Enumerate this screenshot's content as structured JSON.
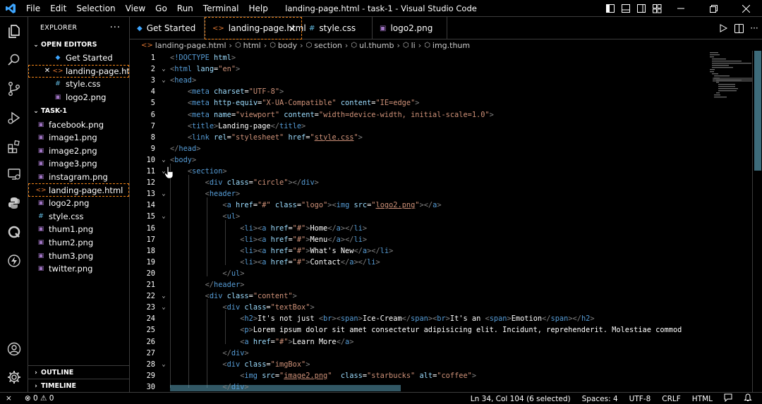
{
  "window": {
    "title": "landing-page.html - task-1 - Visual Studio Code"
  },
  "menu": [
    "File",
    "Edit",
    "Selection",
    "View",
    "Go",
    "Run",
    "Terminal",
    "Help"
  ],
  "sidebar": {
    "header": "EXPLORER",
    "open_editors_label": "OPEN EDITORS",
    "open_editors": [
      {
        "name": "Get Started",
        "icon": "vscode-icon"
      },
      {
        "name": "landing-page.ht...",
        "icon": "html-icon",
        "active": true
      },
      {
        "name": "style.css",
        "icon": "css-icon"
      },
      {
        "name": "logo2.png",
        "icon": "image-icon"
      }
    ],
    "folder_label": "TASK-1",
    "files": [
      {
        "name": "facebook.png",
        "icon": "image-icon"
      },
      {
        "name": "image1.png",
        "icon": "image-icon"
      },
      {
        "name": "image2.png",
        "icon": "image-icon"
      },
      {
        "name": "image3.png",
        "icon": "image-icon"
      },
      {
        "name": "instagram.png",
        "icon": "image-icon"
      },
      {
        "name": "landing-page.html",
        "icon": "html-icon",
        "active": true
      },
      {
        "name": "logo2.png",
        "icon": "image-icon"
      },
      {
        "name": "style.css",
        "icon": "css-icon"
      },
      {
        "name": "thum1.png",
        "icon": "image-icon"
      },
      {
        "name": "thum2.png",
        "icon": "image-icon"
      },
      {
        "name": "thum3.png",
        "icon": "image-icon"
      },
      {
        "name": "twitter.png",
        "icon": "image-icon"
      }
    ],
    "outline_label": "OUTLINE",
    "timeline_label": "TIMELINE"
  },
  "tabs": [
    {
      "label": "Get Started",
      "icon": "vscode-icon"
    },
    {
      "label": "landing-page.html",
      "icon": "html-icon",
      "active": true
    },
    {
      "label": "style.css",
      "icon": "css-icon"
    },
    {
      "label": "logo2.png",
      "icon": "image-icon"
    }
  ],
  "breadcrumb": [
    "landing-page.html",
    "html",
    "body",
    "section",
    "ul.thumb",
    "li",
    "img.thum"
  ],
  "editor": {
    "lines": [
      {
        "n": "1",
        "fold": "",
        "code": "<!DOCTYPE html>"
      },
      {
        "n": "2",
        "fold": "⌄",
        "code": "<html lang=\"en\">"
      },
      {
        "n": "3",
        "fold": "⌄",
        "code": "<head>"
      },
      {
        "n": "4",
        "fold": "",
        "code": "    <meta charset=\"UTF-8\">"
      },
      {
        "n": "5",
        "fold": "",
        "code": "    <meta http-equiv=\"X-UA-Compatible\" content=\"IE=edge\">"
      },
      {
        "n": "6",
        "fold": "",
        "code": "    <meta name=\"viewport\" content=\"width=device-width, initial-scale=1.0\">"
      },
      {
        "n": "7",
        "fold": "",
        "code": "    <title>Landing-page</title>"
      },
      {
        "n": "8",
        "fold": "",
        "code": "    <link rel=\"stylesheet\" href=\"style.css\">"
      },
      {
        "n": "9",
        "fold": "",
        "code": "</head>"
      },
      {
        "n": "10",
        "fold": "⌄",
        "code": "<body>"
      },
      {
        "n": "11",
        "fold": "⌄",
        "code": "    <section>"
      },
      {
        "n": "12",
        "fold": "",
        "code": "        <div class=\"circle\"></div>"
      },
      {
        "n": "13",
        "fold": "⌄",
        "code": "        <header>"
      },
      {
        "n": "14",
        "fold": "",
        "code": "            <a href=\"#\" class=\"logo\"><img src=\"logo2.png\"></a>"
      },
      {
        "n": "15",
        "fold": "⌄",
        "code": "            <ul>"
      },
      {
        "n": "16",
        "fold": "",
        "code": "                <li><a href=\"#\">Home</a></li>"
      },
      {
        "n": "17",
        "fold": "",
        "code": "                <li><a href=\"#\">Menu</a></li>"
      },
      {
        "n": "18",
        "fold": "",
        "code": "                <li><a href=\"#\">What's New</a></li>"
      },
      {
        "n": "19",
        "fold": "",
        "code": "                <li><a href=\"#\">Contact</a></li>"
      },
      {
        "n": "20",
        "fold": "",
        "code": "            </ul>"
      },
      {
        "n": "21",
        "fold": "",
        "code": "        </header>"
      },
      {
        "n": "22",
        "fold": "⌄",
        "code": "        <div class=\"content\">"
      },
      {
        "n": "23",
        "fold": "⌄",
        "code": "            <div class=\"textBox\">"
      },
      {
        "n": "24",
        "fold": "",
        "code": "                <h2>It's not just <br><span>Ice-Cream</span><br>It's an <span>Emotion</span></h2>"
      },
      {
        "n": "25",
        "fold": "",
        "code": "                <p>Lorem ipsum dolor sit amet consectetur adipisicing elit. Incidunt, reprehenderit. Molestiae commod"
      },
      {
        "n": "26",
        "fold": "",
        "code": "                <a href=\"#\">Learn More</a>"
      },
      {
        "n": "27",
        "fold": "",
        "code": "            </div>"
      },
      {
        "n": "28",
        "fold": "⌄",
        "code": "            <div class=\"imgBox\">"
      },
      {
        "n": "29",
        "fold": "",
        "code": "                <img src=\"image2.png\"  class=\"starbucks\" alt=\"coffee\">"
      },
      {
        "n": "30",
        "fold": "",
        "code": "            </div>"
      }
    ]
  },
  "status": {
    "remote": "⨯",
    "problems": "⊗ 0 ⚠ 0",
    "cursor": "Ln 34, Col 104 (6 selected)",
    "spaces": "Spaces: 4",
    "encoding": "UTF-8",
    "eol": "CRLF",
    "language": "HTML"
  },
  "colors": {
    "accent_border": "#f38518",
    "tag": "#569cd6",
    "attribute": "#9cdcfe",
    "string": "#ce9178"
  }
}
